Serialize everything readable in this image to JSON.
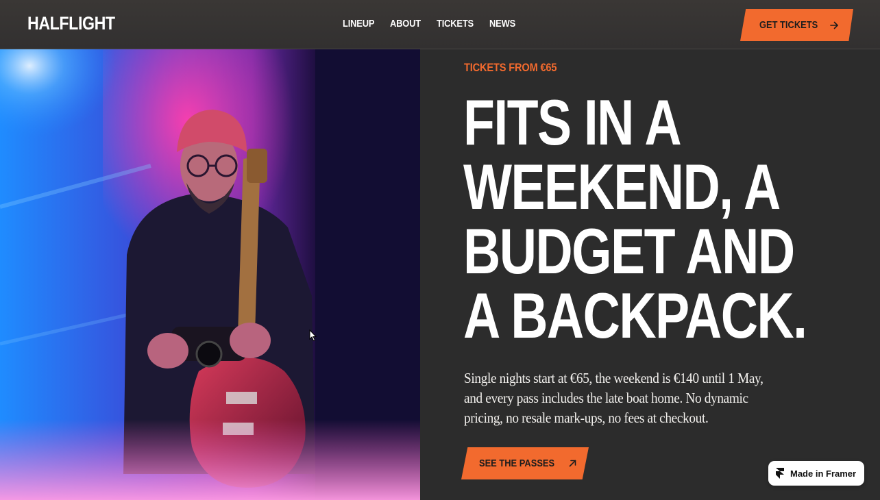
{
  "header": {
    "logo": "HALFLIGHT",
    "nav": [
      "LINEUP",
      "ABOUT",
      "TICKETS",
      "NEWS"
    ],
    "cta_label": "GET TICKETS",
    "cta_icon": "arrow-right-icon"
  },
  "hero": {
    "eyebrow": "TICKETS FROM €65",
    "headline": [
      "FITS IN A",
      "WEEKEND, A",
      "BUDGET AND",
      "A BACKPACK."
    ],
    "body": "Single nights start at €65, the weekend is €140 until 1 May, and every pass includes the late boat home. No dynamic pricing, no resale mark-ups, no fees at checkout.",
    "cta_label": "SEE THE PASSES",
    "cta_icon": "arrow-up-right-icon"
  },
  "badge": {
    "label": "Made in Framer",
    "icon": "framer-logo-icon"
  },
  "colors": {
    "accent": "#f26a2e",
    "background": "#2c2c2c",
    "text": "#ffffff"
  }
}
